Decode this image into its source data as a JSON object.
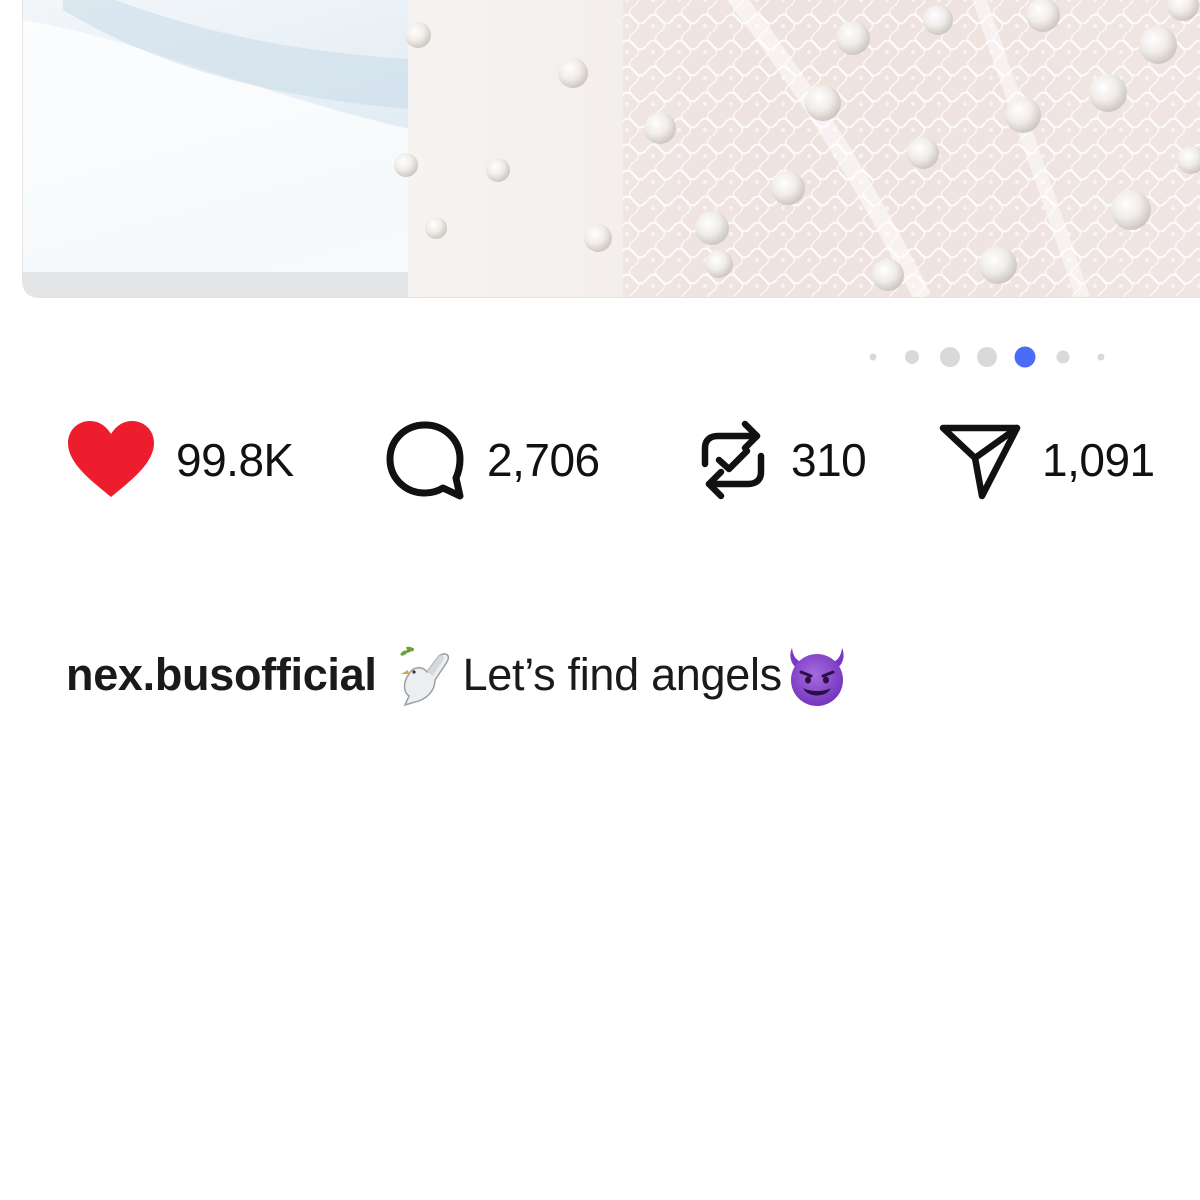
{
  "post": {
    "media": {
      "description_icon": "wedding-dress-lace-pearls-photo"
    },
    "carousel": {
      "dot_count": 7,
      "active_index": 4,
      "active_color": "#4a6cf7",
      "inactive_color": "#d9d9d9"
    },
    "actions": {
      "like": {
        "icon": "heart-icon",
        "count": "99.8K",
        "color": "#ee1d2d"
      },
      "comment": {
        "icon": "comment-icon",
        "count": "2,706"
      },
      "repost": {
        "icon": "repost-icon",
        "count": "310"
      },
      "share": {
        "icon": "share-icon",
        "count": "1,091"
      }
    },
    "caption": {
      "username": "nex.busofficial",
      "dove_emoji": "dove-emoji",
      "text": "Let’s find angels",
      "end_emoji": "smiling-devil-emoji"
    }
  }
}
